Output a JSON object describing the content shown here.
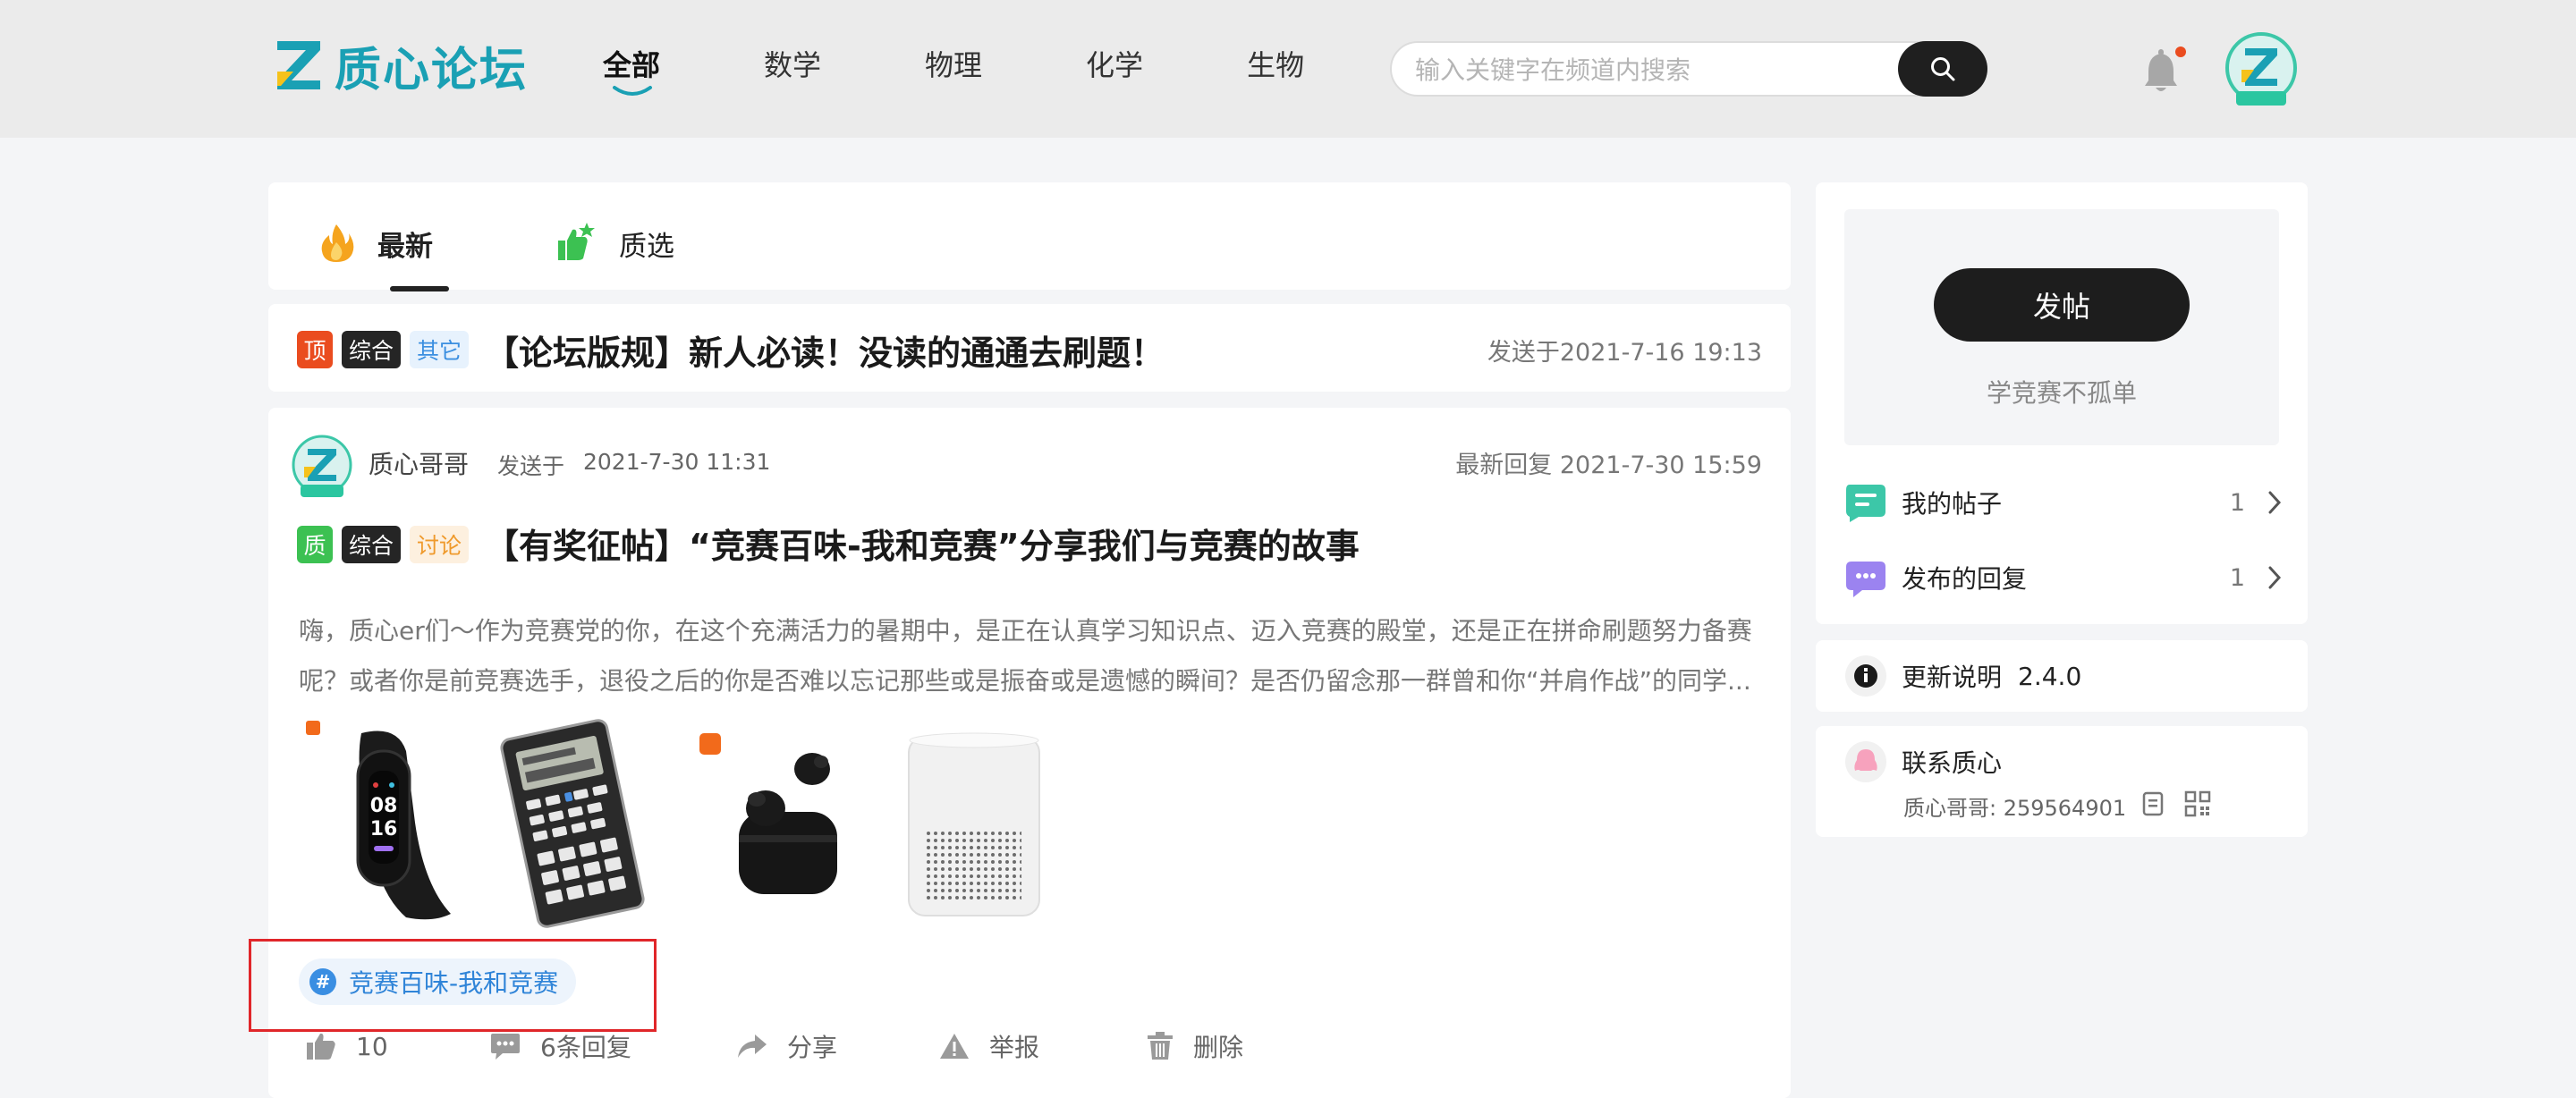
{
  "brand": {
    "name": "质心论坛"
  },
  "nav": [
    {
      "label": "全部",
      "active": true
    },
    {
      "label": "数学"
    },
    {
      "label": "物理"
    },
    {
      "label": "化学"
    },
    {
      "label": "生物"
    }
  ],
  "search": {
    "placeholder": "输入关键字在频道内搜索",
    "value": ""
  },
  "tabs": [
    {
      "label": "最新",
      "active": true
    },
    {
      "label": "质选"
    }
  ],
  "pinned": {
    "tags": [
      "顶",
      "综合",
      "其它"
    ],
    "title": "【论坛版规】新人必读！没读的通通去刷题！",
    "date": "发送于2021-7-16 19:13"
  },
  "post": {
    "author": "质心哥哥",
    "posted_label": "发送于",
    "posted_date": "2021-7-30 11:31",
    "last_reply": "最新回复 2021-7-30 15:59",
    "tags": [
      "质",
      "综合",
      "讨论"
    ],
    "title": "【有奖征帖】“竞赛百味-我和竞赛”分享我们与竞赛的故事",
    "excerpt": "嗨，质心er们～作为竞赛党的你，在这个充满活力的暑期中，是正在认真学习知识点、迈入竞赛的殿堂，还是正在拼命刷题努力备赛呢？或者你是前竞赛选手，退役之后的你是否难以忘记那些或是振奋或是遗憾的瞬间？是否仍留念那一群曾和你“并肩作战”的同学...",
    "band_display": [
      "08",
      "16"
    ],
    "topic": "竞赛百味-我和竞赛",
    "actions": {
      "likes": "10",
      "replies": "6条回复",
      "share": "分享",
      "report": "举报",
      "delete": "删除"
    }
  },
  "sidebar": {
    "post_button": "发帖",
    "slogan": "学竞赛不孤单",
    "my_posts": {
      "label": "我的帖子",
      "count": "1"
    },
    "my_replies": {
      "label": "发布的回复",
      "count": "1"
    },
    "changelog": {
      "label": "更新说明",
      "version": "2.4.0"
    },
    "contact": {
      "label": "联系质心",
      "detail": "质心哥哥: 259564901"
    }
  },
  "colors": {
    "brand": "#1aa0b4",
    "pin_red": "#ea4c1f",
    "tag_green": "#3cc152",
    "topic_blue": "#2f84d8",
    "highlight": "#e0262a"
  }
}
